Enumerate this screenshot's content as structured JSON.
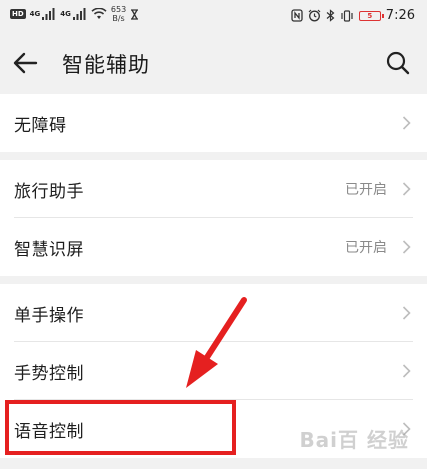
{
  "status_bar": {
    "network_1": "4G",
    "network_2": "4G",
    "speed_value": "653",
    "speed_unit": "B/s",
    "battery_level": "5",
    "time": "7:26"
  },
  "header": {
    "title": "智能辅助",
    "back_icon": "arrow-left-icon",
    "search_icon": "search-icon"
  },
  "groups": [
    {
      "items": [
        {
          "label": "无障碍",
          "status": ""
        }
      ]
    },
    {
      "items": [
        {
          "label": "旅行助手",
          "status": "已开启"
        },
        {
          "label": "智慧识屏",
          "status": "已开启"
        }
      ]
    },
    {
      "items": [
        {
          "label": "单手操作",
          "status": ""
        },
        {
          "label": "手势控制",
          "status": ""
        },
        {
          "label": "语音控制",
          "status": ""
        }
      ]
    }
  ],
  "annotation": {
    "highlight_color": "#e52020"
  },
  "watermark": {
    "text": "Bai百 经验"
  },
  "colors": {
    "background": "#f1f1f1",
    "card": "#ffffff",
    "text_primary": "#1e1e1e",
    "text_secondary": "#8a8a8a",
    "accent_red": "#e52020"
  }
}
